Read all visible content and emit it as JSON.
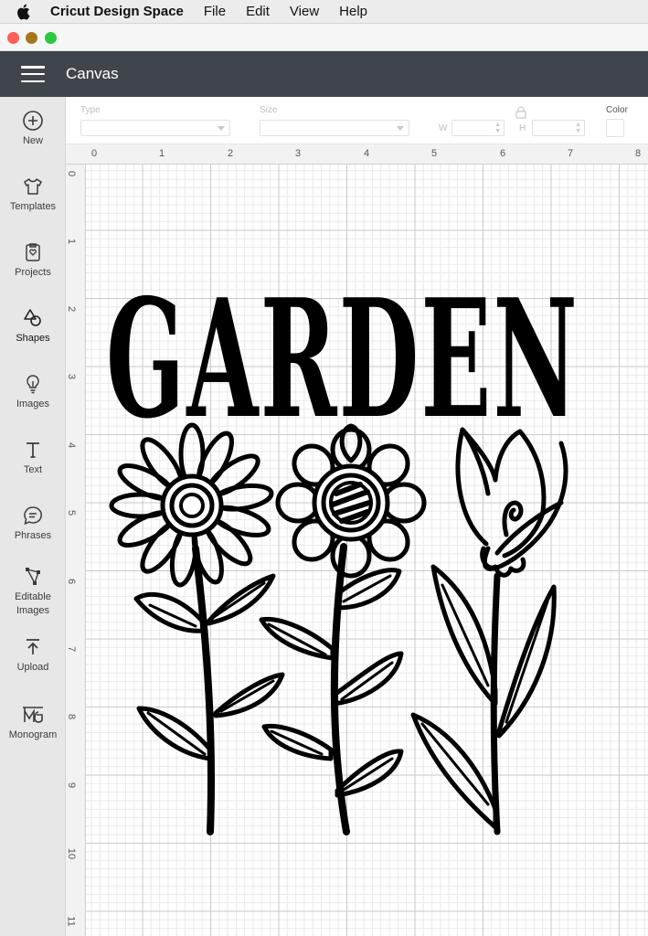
{
  "menubar": {
    "app_name": "Cricut Design Space",
    "items": [
      "File",
      "Edit",
      "View",
      "Help"
    ]
  },
  "window": {
    "controls": [
      "close",
      "minimize",
      "zoom"
    ],
    "colors": {
      "close": "#ff5f57",
      "minimize": "#a6761c",
      "zoom": "#2ac840"
    }
  },
  "header": {
    "menu_icon": "hamburger-icon",
    "title": "Canvas",
    "bg_color": "#40454b"
  },
  "sidebar": {
    "items": [
      {
        "label": "New",
        "icon": "plus-circle-icon"
      },
      {
        "label": "Templates",
        "icon": "tshirt-icon"
      },
      {
        "label": "Projects",
        "icon": "projects-icon"
      },
      {
        "label": "Shapes",
        "icon": "shapes-icon"
      },
      {
        "label": "Images",
        "icon": "lightbulb-icon"
      },
      {
        "label": "Text",
        "icon": "text-icon"
      },
      {
        "label": "Phrases",
        "icon": "speech-bubble-icon"
      },
      {
        "label": "Editable Images",
        "icon": "editable-images-icon"
      },
      {
        "label": "Upload",
        "icon": "upload-icon"
      },
      {
        "label": "Monogram",
        "icon": "monogram-icon"
      }
    ]
  },
  "toolbar": {
    "type_label": "Type",
    "size_label": "Size",
    "width_label": "W",
    "height_label": "H",
    "color_label": "Color",
    "lock_icon": "lock-icon"
  },
  "rulers": {
    "top": [
      "0",
      "1",
      "2",
      "3",
      "4",
      "5",
      "6",
      "7",
      "8"
    ],
    "left": [
      "0",
      "1",
      "2",
      "3",
      "4",
      "5",
      "6",
      "7",
      "8",
      "9",
      "10",
      "11"
    ]
  },
  "design": {
    "word": "GARDEN",
    "flowers": [
      "daisy",
      "sunflower",
      "tulip"
    ]
  }
}
